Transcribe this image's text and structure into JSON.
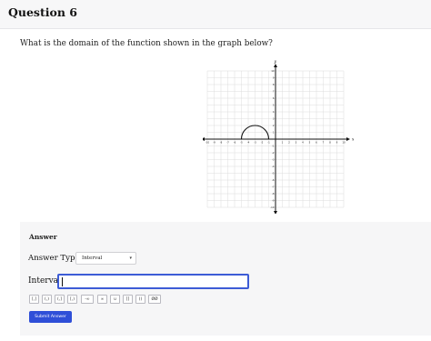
{
  "question": {
    "title": "Question 6",
    "prompt": "What is the domain of the function shown in the graph below?"
  },
  "graph": {
    "x_axis_label": "x",
    "y_axis_label": "y",
    "x_range": [
      -10,
      10
    ],
    "y_range": [
      -10,
      10
    ],
    "x_tick_labels": [
      "-10",
      "-9",
      "-8",
      "-7",
      "-6",
      "-5",
      "-4",
      "-3",
      "-2",
      "-1",
      "1",
      "2",
      "3",
      "4",
      "5",
      "6",
      "7",
      "8",
      "9",
      "10"
    ],
    "y_tick_labels": [
      "10",
      "9",
      "8",
      "7",
      "6",
      "5",
      "4",
      "3",
      "2",
      "1",
      "-1",
      "-2",
      "-3",
      "-4",
      "-5",
      "-6",
      "-7",
      "-8",
      "-9",
      "-10"
    ],
    "curve": {
      "shape": "upper semicircle",
      "center": [
        -3,
        0
      ],
      "radius": 2
    }
  },
  "answer": {
    "heading": "Answer",
    "type_label": "Answer Type:",
    "type_value": "Interval",
    "interval_label": "Interval:",
    "interval_value": "",
    "symbols": [
      "[,]",
      "(,)",
      "(,]",
      "[,)",
      "-∞",
      "∞",
      "∪",
      "[]",
      "()",
      "ØØ"
    ],
    "submit_label": "Submit Answer"
  },
  "colors": {
    "accent": "#2f4fd8",
    "input_focus": "#3d5cd6",
    "panel": "#f6f6f7"
  }
}
